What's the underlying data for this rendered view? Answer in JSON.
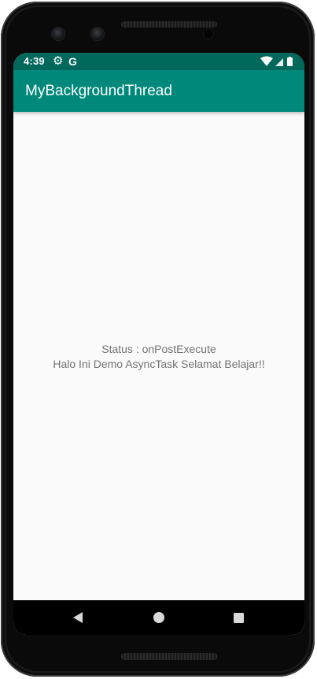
{
  "status_bar": {
    "time": "4:39",
    "icons_left": [
      "gear-icon",
      "google-g-icon"
    ],
    "google_letter": "G",
    "icons_right": [
      "wifi-icon",
      "signal-icon",
      "battery-icon"
    ],
    "color": "#00695c"
  },
  "app_bar": {
    "title": "MyBackgroundThread",
    "color": "#00897b"
  },
  "content": {
    "status_text": "Status : onPostExecute",
    "message_text": "Halo Ini Demo AsyncTask Selamat Belajar!!"
  },
  "nav_bar": {
    "buttons": [
      "back-icon",
      "home-icon",
      "recents-icon"
    ]
  }
}
